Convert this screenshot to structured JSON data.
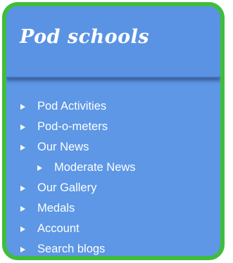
{
  "panel": {
    "title": "Pod schools",
    "accent_border": "#3fbd3c",
    "background": "#5d97e6"
  },
  "nav": {
    "items": [
      {
        "label": "Pod Activities",
        "icon": "arrow-right-icon",
        "level": 0
      },
      {
        "label": "Pod-o-meters",
        "icon": "arrow-right-icon",
        "level": 0
      },
      {
        "label": "Our News",
        "icon": "arrow-right-icon",
        "level": 0
      },
      {
        "label": "Moderate News",
        "icon": "arrow-right-icon",
        "level": 1
      },
      {
        "label": "Our Gallery",
        "icon": "arrow-right-icon",
        "level": 0
      },
      {
        "label": "Medals",
        "icon": "arrow-right-icon",
        "level": 0
      },
      {
        "label": "Account",
        "icon": "arrow-right-icon",
        "level": 0
      },
      {
        "label": "Search blogs",
        "icon": "arrow-right-icon",
        "level": 0
      }
    ]
  }
}
